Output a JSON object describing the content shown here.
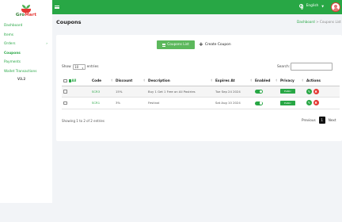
{
  "brand": {
    "name_part1": "Gro",
    "name_part2": "Mart"
  },
  "sidebar": {
    "items": [
      {
        "label": "Dashboard"
      },
      {
        "label": "Items"
      },
      {
        "label": "Orders",
        "has_children": true
      },
      {
        "label": "Coupons",
        "active": true
      },
      {
        "label": "Payments"
      },
      {
        "label": "Wallet Transactions"
      }
    ],
    "version": "V3.2"
  },
  "topbar": {
    "language": "English"
  },
  "page": {
    "title": "Coupons",
    "breadcrumb": {
      "home": "Dashboard",
      "separator": ">",
      "current": "Coupons List"
    }
  },
  "toolbar": {
    "list_button": "Coupons List",
    "create_button": "Create Coupon"
  },
  "table_controls": {
    "show_label": "Show",
    "entries_value": "10",
    "entries_label": "entries",
    "search_label": "Search:",
    "search_value": ""
  },
  "table": {
    "select_all_label": "All",
    "columns": [
      "Code",
      "Discount",
      "Description",
      "Expires At",
      "Enabled",
      "Privacy",
      "Actions"
    ],
    "rows": [
      {
        "code": "SCR3",
        "discount": "15%",
        "description": "Buy 1 Get 1 Free on All Pastries",
        "expires": "Tue Sep 24 2024",
        "enabled": true,
        "privacy": "Public"
      },
      {
        "code": "SCR1",
        "discount": "3%",
        "description": "Festival",
        "expires": "Sat Aug 10 2024",
        "enabled": true,
        "privacy": "Public"
      }
    ]
  },
  "footer": {
    "showing": "Showing 1 to 2 of 2 entries",
    "previous": "Previous",
    "current_page": "1",
    "next": "Next"
  },
  "colors": {
    "primary": "#28a745",
    "danger": "#e53935"
  }
}
